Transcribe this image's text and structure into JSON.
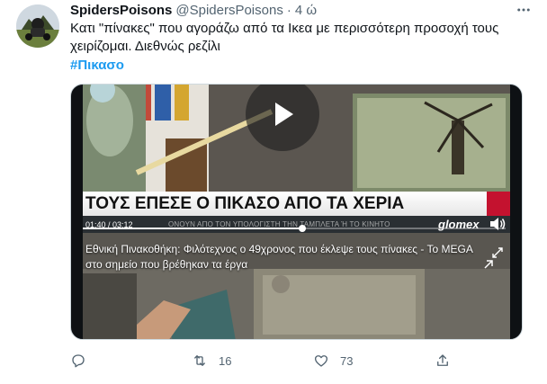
{
  "tweet": {
    "display_name": "SpidersPoisons",
    "handle": "@SpidersPoisons",
    "separator": "·",
    "time": "4 ώ",
    "text_line1": "Κατι \"πίνακες\" που αγοράζω από τα Ικεα με περισσότερη προσοχή τους",
    "text_line2": "χειρίζομαι. Διεθνώς ρεζίλι",
    "hashtag": "#Πικασο"
  },
  "video": {
    "banner": "ΤΟΥΣ ΕΠΕΣΕ Ο ΠΙΚΑΣΟ ΑΠΟ ΤΑ ΧΕΡΙΑ",
    "time_display": "01:40 / 03:12",
    "progress": 0.52,
    "ticker": "ΟΝΟΥΝ ΑΠΟ ΤΟΝ ΥΠΟΛΟΓΙΣΤΗ ΤΗΝ ΤΑΜΠΛΕΤΑ Ή ΤΟ ΚΙΝΗΤΟ",
    "brand": "glomex",
    "related_title": "Εθνική Πινακοθήκη: Φιλότεχνος ο 49χρονος που έκλεψε τους πίνακες - Το MEGA στο σημείο που βρέθηκαν τα έργα",
    "icons": [
      "play-icon",
      "volume-icon",
      "expand-icon",
      "arrow-up-right-icon"
    ]
  },
  "actions": {
    "reply_count": "",
    "retweet_count": "16",
    "like_count": "73",
    "icons": [
      "reply-icon",
      "retweet-icon",
      "like-icon",
      "share-icon"
    ]
  },
  "colors": {
    "accent": "#1d9bf0",
    "secondary_text": "#536471",
    "banner_red": "#c4122f"
  }
}
